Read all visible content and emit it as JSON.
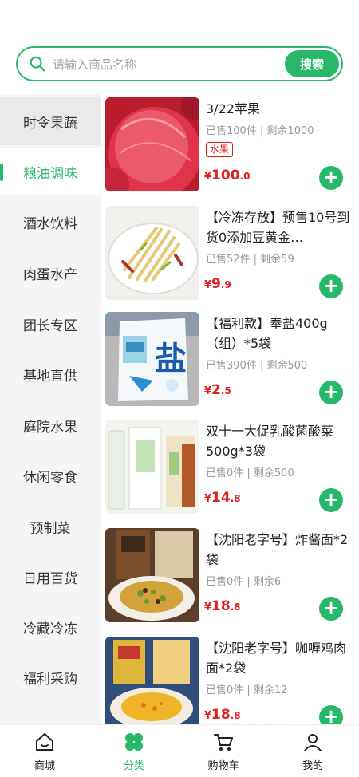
{
  "search": {
    "placeholder": "请输入商品名称",
    "button_label": "搜索"
  },
  "colors": {
    "accent": "#27b86a",
    "price": "#e02020"
  },
  "sidebar": {
    "items": [
      {
        "label": "时令果蔬",
        "active": false
      },
      {
        "label": "粮油调味",
        "active": true
      },
      {
        "label": "酒水饮料",
        "active": false
      },
      {
        "label": "肉蛋水产",
        "active": false
      },
      {
        "label": "团长专区",
        "active": false
      },
      {
        "label": "基地直供",
        "active": false
      },
      {
        "label": "庭院水果",
        "active": false
      },
      {
        "label": "休闲零食",
        "active": false
      },
      {
        "label": "预制菜",
        "active": false
      },
      {
        "label": "日用百货",
        "active": false
      },
      {
        "label": "冷藏冷冻",
        "active": false
      },
      {
        "label": "福利采购",
        "active": false
      }
    ]
  },
  "products": [
    {
      "name": "3/22苹果",
      "stats": "已售100件 | 剩余1000",
      "tag": "水果",
      "currency": "¥",
      "price_int": "100",
      "price_dec": ".0",
      "image": "apple-photo"
    },
    {
      "name": "【冷冻存放】预售10号到货0添加豆黄金…",
      "stats": "已售52件 | 剩余59",
      "currency": "¥",
      "price_int": "9",
      "price_dec": ".9",
      "image": "tofu-skin-photo"
    },
    {
      "name": "【福利款】奉盐400g（组）*5袋",
      "stats": "已售390件 | 剩余500",
      "currency": "¥",
      "price_int": "2",
      "price_dec": ".5",
      "image": "salt-bag-photo"
    },
    {
      "name": "双十一大促乳酸菌酸菜500g*3袋",
      "stats": "已售0件 | 剩余500",
      "currency": "¥",
      "price_int": "14",
      "price_dec": ".8",
      "image": "pickled-cabbage-photo"
    },
    {
      "name": "【沈阳老字号】炸酱面*2袋",
      "stats": "已售0件 | 剩余6",
      "currency": "¥",
      "price_int": "18",
      "price_dec": ".8",
      "image": "zhajiang-noodles-photo"
    },
    {
      "name": "【沈阳老字号】咖喱鸡肉面*2袋",
      "stats": "已售0件 | 剩余12",
      "currency": "¥",
      "price_int": "18",
      "price_dec": ".8",
      "image": "curry-noodles-photo"
    }
  ],
  "add_button_symbol": "+",
  "bottom_nav": [
    {
      "label": "商城",
      "icon": "home-icon",
      "active": false
    },
    {
      "label": "分类",
      "icon": "clover-icon",
      "active": true
    },
    {
      "label": "购物车",
      "icon": "cart-icon",
      "active": false
    },
    {
      "label": "我的",
      "icon": "user-icon",
      "active": false
    }
  ],
  "watermark": {
    "text": "2889.com",
    "icon": "watermark-logo"
  }
}
